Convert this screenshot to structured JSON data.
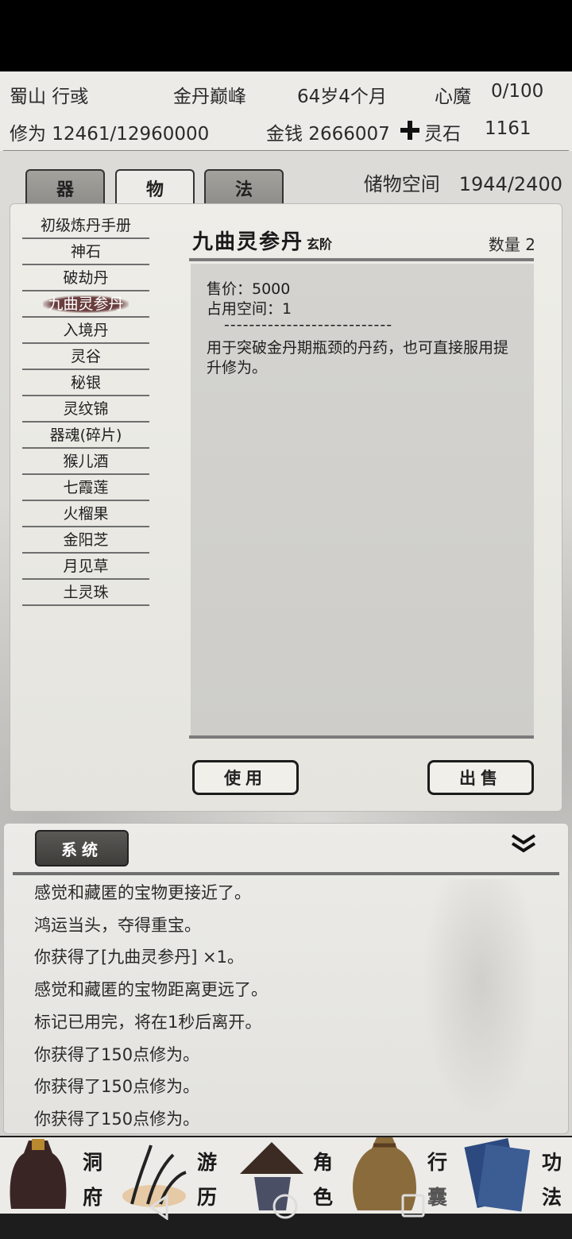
{
  "header": {
    "location": "蜀山 行彧",
    "realm": "金丹巅峰",
    "age": "64岁4个月",
    "demon_label": "心魔",
    "demon_value": "0/100",
    "cultivation": "修为 12461/12960000",
    "money": "金钱 2666007",
    "spirit_stone_label": "灵石",
    "spirit_stone_value": "1161"
  },
  "tabs": [
    {
      "label": "器"
    },
    {
      "label": "物"
    },
    {
      "label": "法"
    }
  ],
  "storage": "储物空间　1944/2400",
  "items": [
    "初级炼丹手册",
    "神石",
    "破劫丹",
    "九曲灵参丹",
    "入境丹",
    "灵谷",
    "秘银",
    "灵纹锦",
    "器魂(碎片)",
    "猴儿酒",
    "七霞莲",
    "火榴果",
    "金阳芝",
    "月见草",
    "土灵珠"
  ],
  "detail": {
    "name": "九曲灵参丹",
    "grade": "玄阶",
    "quantity": "数量 2",
    "price": "售价：5000",
    "space": "占用空间：1",
    "separator": "---------------------------",
    "description": "用于突破金丹期瓶颈的丹药，也可直接服用提升修为。"
  },
  "buttons": {
    "use": "使用",
    "sell": "出售"
  },
  "log": {
    "system_label": "系统",
    "lines": [
      "感觉和藏匿的宝物更接近了。",
      "鸿运当头，夺得重宝。",
      "你获得了[九曲灵参丹] ×1。",
      "感觉和藏匿的宝物距离更远了。",
      "标记已用完，将在1秒后离开。",
      "你获得了150点修为。",
      "你获得了150点修为。",
      "你获得了150点修为。"
    ]
  },
  "nav": [
    {
      "label_top": "洞",
      "label_bottom": "府",
      "icon": "dwelling-icon"
    },
    {
      "label_top": "游",
      "label_bottom": "历",
      "icon": "travel-icon"
    },
    {
      "label_top": "角",
      "label_bottom": "色",
      "icon": "character-icon"
    },
    {
      "label_top": "行",
      "label_bottom": "囊",
      "icon": "bag-icon"
    },
    {
      "label_top": "功",
      "label_bottom": "法",
      "icon": "technique-icon"
    }
  ],
  "colors": {
    "selected_item": "#6a3e3e",
    "panel": "#eeede8",
    "dark": "#1d1d1d"
  }
}
